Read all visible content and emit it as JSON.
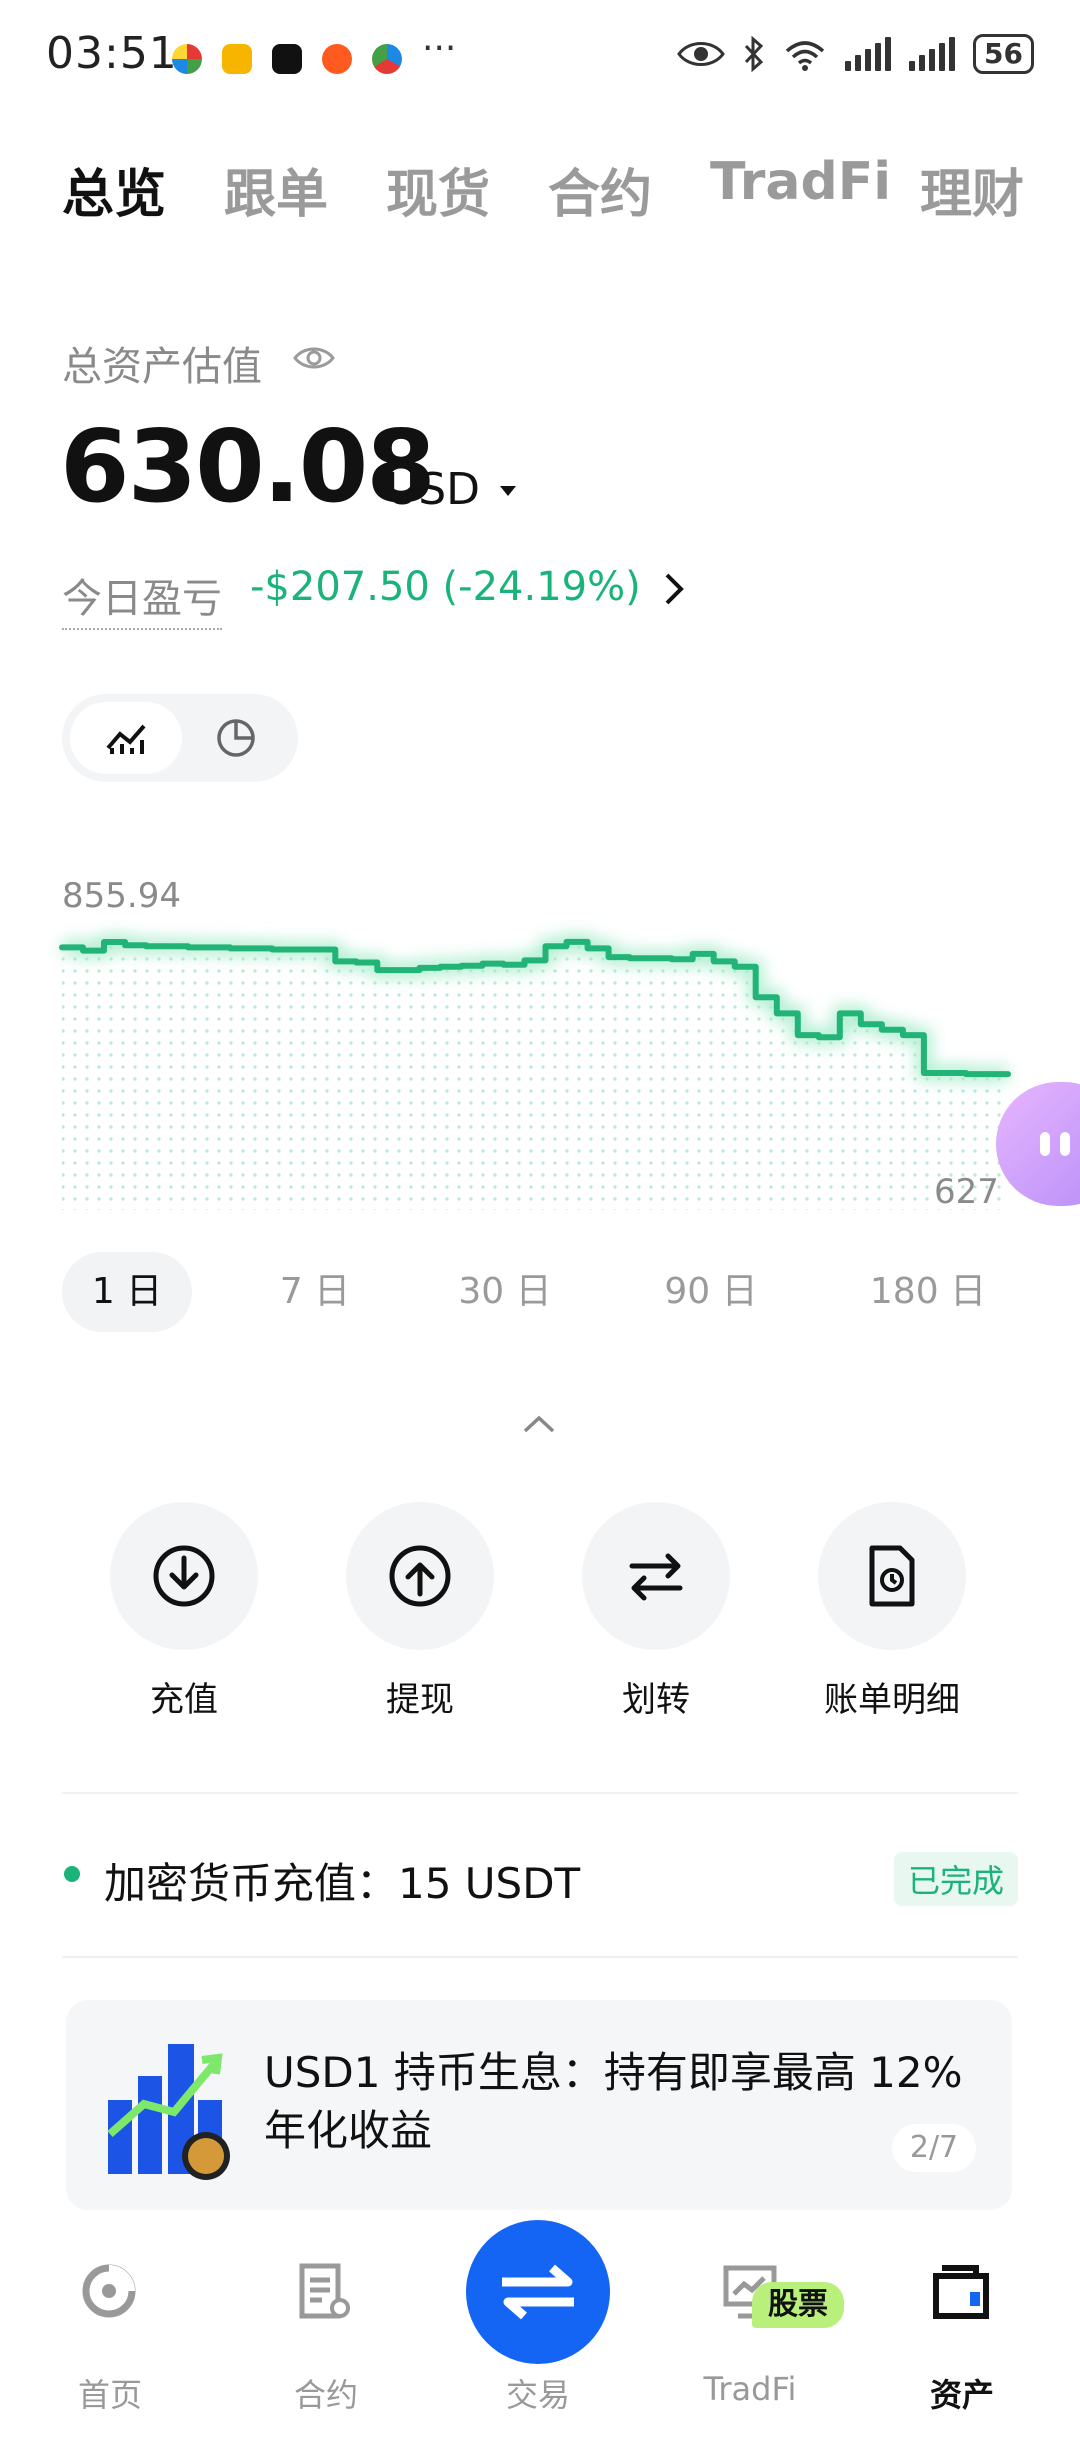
{
  "status_bar": {
    "time": "03:51",
    "battery": "56"
  },
  "tabs": [
    {
      "label": "总览"
    },
    {
      "label": "跟单"
    },
    {
      "label": "现货"
    },
    {
      "label": "合约"
    },
    {
      "label": "TradFi"
    },
    {
      "label": "理财"
    }
  ],
  "assets": {
    "label": "总资产估值",
    "total": "630.08",
    "currency": "USD",
    "pnl_label": "今日盈亏",
    "pnl_value": "-$207.50 (-24.19%)"
  },
  "chart_data": {
    "type": "line",
    "max_label": "855.94",
    "min_label": "627",
    "ylim": [
      627,
      855.94
    ],
    "color": "#1ab37a",
    "values": [
      851,
      848,
      855.9,
      853,
      852,
      852,
      851,
      851,
      850,
      850,
      849,
      849,
      849,
      838,
      837,
      830,
      830,
      832,
      833,
      834,
      836,
      835,
      839,
      852,
      856,
      850,
      842,
      841,
      841,
      840,
      845,
      838,
      833,
      805,
      790,
      770,
      768,
      790,
      780,
      775,
      770,
      735,
      735,
      734,
      734,
      734
    ]
  },
  "ranges": [
    {
      "label": "1 日"
    },
    {
      "label": "7 日"
    },
    {
      "label": "30 日"
    },
    {
      "label": "90 日"
    },
    {
      "label": "180 日"
    }
  ],
  "actions": [
    {
      "label": "充值",
      "icon": "deposit-icon"
    },
    {
      "label": "提现",
      "icon": "withdraw-icon"
    },
    {
      "label": "划转",
      "icon": "transfer-icon"
    },
    {
      "label": "账单明细",
      "icon": "bill-icon"
    }
  ],
  "notice": {
    "text": "加密货币充值：15 USDT",
    "status": "已完成"
  },
  "promo": {
    "text": "USD1 持币生息：持有即享最高 12% 年化收益",
    "page": "2/7"
  },
  "bottom_nav": [
    {
      "label": "首页"
    },
    {
      "label": "合约"
    },
    {
      "label": "交易"
    },
    {
      "label": "TradFi"
    },
    {
      "label": "资产"
    }
  ],
  "stock_badge": "股票",
  "colors": {
    "accent": "#1565f5",
    "positive": "#1ab37a"
  }
}
